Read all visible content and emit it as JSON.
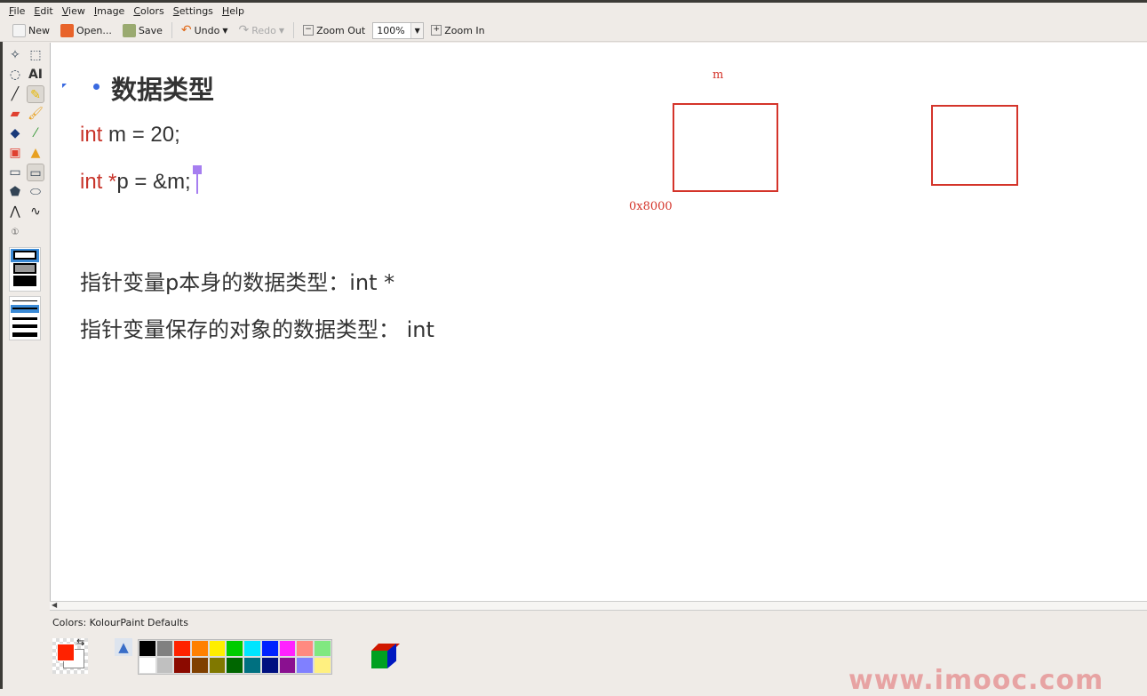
{
  "menu": [
    "File",
    "Edit",
    "View",
    "Image",
    "Colors",
    "Settings",
    "Help"
  ],
  "toolbar": {
    "new": "New",
    "open": "Open...",
    "save": "Save",
    "undo": "Undo",
    "redo": "Redo",
    "zoom_out": "Zoom Out",
    "zoom_value": "100%",
    "zoom_in": "Zoom In"
  },
  "canvas": {
    "heading": "数据类型",
    "line1_kw": "int",
    "line1_rest": " m = 20;",
    "line2_kw": "int *",
    "line2_rest": "p = &m;",
    "desc1": "指针变量p本身的数据类型：int *",
    "desc2": "指针变量保存的对象的数据类型： int",
    "label_m": "m",
    "label_addr": "0x8000"
  },
  "colors": {
    "label": "Colors: KolourPaint Defaults",
    "foreground": "#ff2200",
    "palette": [
      "#000000",
      "#808080",
      "#ff2200",
      "#ff8000",
      "#ffee00",
      "#00cc00",
      "#00e5ff",
      "#0022ff",
      "#ff22ff",
      "#ff8a80",
      "#80e880",
      "#ffffff",
      "#c0c0c0",
      "#8b0a00",
      "#804000",
      "#807800",
      "#006600",
      "#007080",
      "#001080",
      "#8a1090",
      "#8080ff",
      "#fff080"
    ]
  },
  "watermark": "www.imooc.com"
}
